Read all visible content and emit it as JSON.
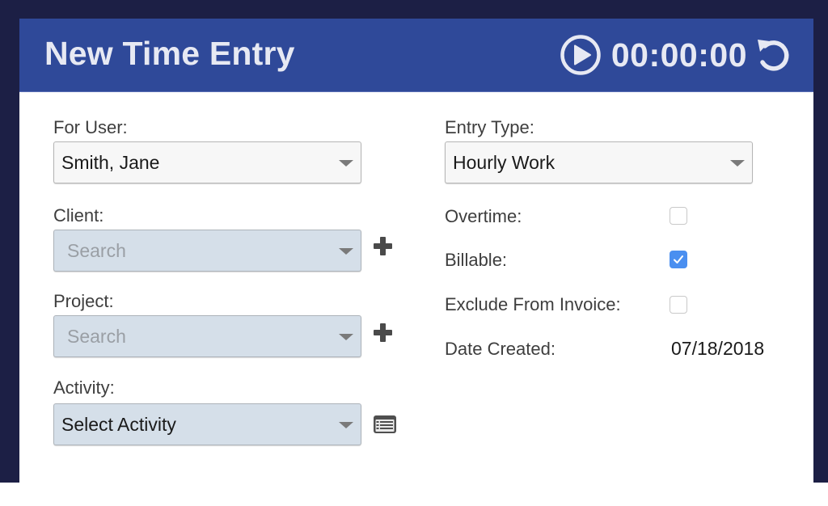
{
  "header": {
    "title": "New Time Entry",
    "timer": "00:00:00",
    "play_icon": "play-circle-icon",
    "reset_icon": "reset-icon"
  },
  "left_column": {
    "for_user": {
      "label": "For User:",
      "value": "Smith, Jane"
    },
    "client": {
      "label": "Client:",
      "placeholder": "Search",
      "add_icon": "plus-icon"
    },
    "project": {
      "label": "Project:",
      "placeholder": "Search",
      "add_icon": "plus-icon"
    },
    "activity": {
      "label": "Activity:",
      "value": "Select Activity",
      "list_icon": "list-icon"
    }
  },
  "right_column": {
    "entry_type": {
      "label": "Entry Type:",
      "value": "Hourly Work"
    },
    "overtime": {
      "label": "Overtime:",
      "checked": false
    },
    "billable": {
      "label": "Billable:",
      "checked": true
    },
    "exclude_from_invoice": {
      "label": "Exclude From Invoice:",
      "checked": false
    },
    "date_created": {
      "label": "Date Created:",
      "value": "07/18/2018"
    }
  },
  "colors": {
    "backdrop": "#1c1f45",
    "header": "#2f4999",
    "header_text": "#e7e9f3",
    "disabled_field": "#d5dfe9",
    "checkbox_checked": "#4a8ff0"
  }
}
